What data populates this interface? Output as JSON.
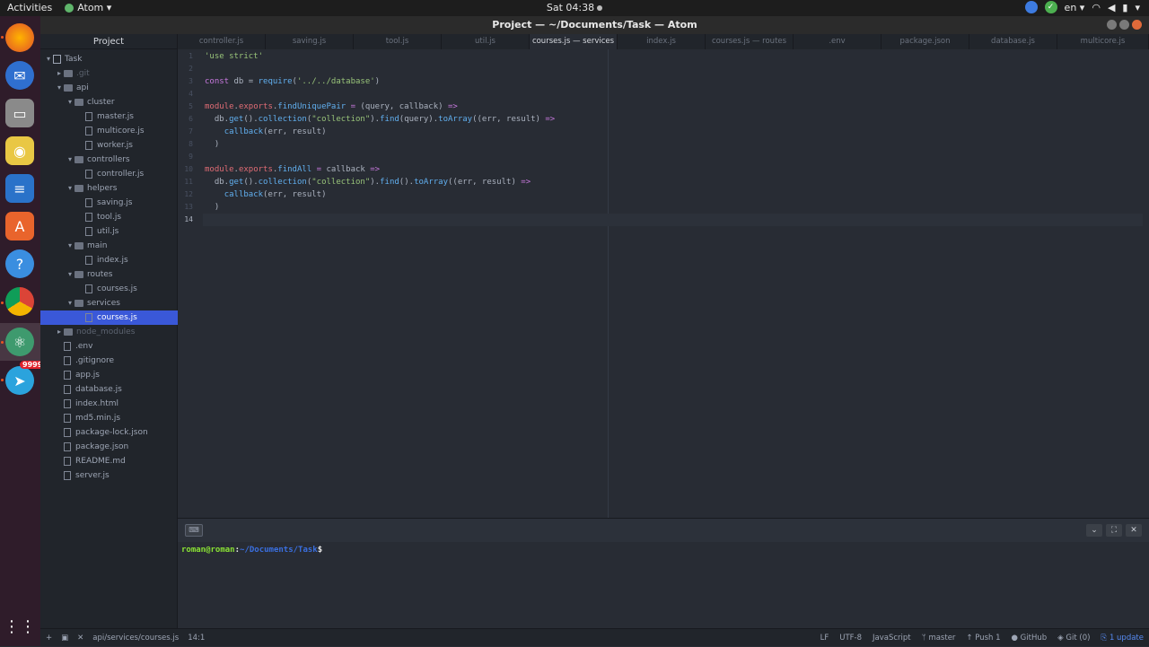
{
  "topbar": {
    "activities": "Activities",
    "app_name": "Atom",
    "clock": "Sat 04:38",
    "lang": "en",
    "tray_icons": [
      "chrome-remote-icon",
      "check-icon",
      "wifi-icon",
      "volume-icon",
      "battery-icon",
      "power-icon"
    ]
  },
  "window": {
    "title": "Project — ~/Documents/Task — Atom"
  },
  "dock": {
    "apps": [
      "firefox",
      "thunderbird",
      "files",
      "rhythmbox",
      "libreoffice-writer",
      "software-center",
      "help",
      "chrome",
      "atom",
      "telegram"
    ],
    "telegram_badge": "9999"
  },
  "tree": {
    "header": "Project",
    "items": [
      {
        "label": "Task",
        "type": "repo",
        "depth": 0,
        "expanded": true
      },
      {
        "label": ".git",
        "type": "folder",
        "depth": 1,
        "expanded": false,
        "dim": true
      },
      {
        "label": "api",
        "type": "folder",
        "depth": 1,
        "expanded": true
      },
      {
        "label": "cluster",
        "type": "folder",
        "depth": 2,
        "expanded": true
      },
      {
        "label": "master.js",
        "type": "file",
        "depth": 3
      },
      {
        "label": "multicore.js",
        "type": "file",
        "depth": 3
      },
      {
        "label": "worker.js",
        "type": "file",
        "depth": 3
      },
      {
        "label": "controllers",
        "type": "folder",
        "depth": 2,
        "expanded": true
      },
      {
        "label": "controller.js",
        "type": "file",
        "depth": 3
      },
      {
        "label": "helpers",
        "type": "folder",
        "depth": 2,
        "expanded": true
      },
      {
        "label": "saving.js",
        "type": "file",
        "depth": 3
      },
      {
        "label": "tool.js",
        "type": "file",
        "depth": 3
      },
      {
        "label": "util.js",
        "type": "file",
        "depth": 3
      },
      {
        "label": "main",
        "type": "folder",
        "depth": 2,
        "expanded": true
      },
      {
        "label": "index.js",
        "type": "file",
        "depth": 3
      },
      {
        "label": "routes",
        "type": "folder",
        "depth": 2,
        "expanded": true
      },
      {
        "label": "courses.js",
        "type": "file",
        "depth": 3
      },
      {
        "label": "services",
        "type": "folder",
        "depth": 2,
        "expanded": true
      },
      {
        "label": "courses.js",
        "type": "file",
        "depth": 3,
        "selected": true
      },
      {
        "label": "node_modules",
        "type": "folder",
        "depth": 1,
        "expanded": false,
        "dim": true
      },
      {
        "label": ".env",
        "type": "file",
        "depth": 1
      },
      {
        "label": ".gitignore",
        "type": "file",
        "depth": 1
      },
      {
        "label": "app.js",
        "type": "file",
        "depth": 1
      },
      {
        "label": "database.js",
        "type": "file",
        "depth": 1
      },
      {
        "label": "index.html",
        "type": "file",
        "depth": 1
      },
      {
        "label": "md5.min.js",
        "type": "file",
        "depth": 1
      },
      {
        "label": "package-lock.json",
        "type": "file",
        "depth": 1
      },
      {
        "label": "package.json",
        "type": "file",
        "depth": 1
      },
      {
        "label": "README.md",
        "type": "file",
        "depth": 1
      },
      {
        "label": "server.js",
        "type": "file",
        "depth": 1
      }
    ]
  },
  "tabs": [
    {
      "label": "controller.js"
    },
    {
      "label": "saving.js"
    },
    {
      "label": "tool.js"
    },
    {
      "label": "util.js"
    },
    {
      "label": "courses.js — services",
      "active": true
    },
    {
      "label": "index.js"
    },
    {
      "label": "courses.js — routes"
    },
    {
      "label": ".env"
    },
    {
      "label": "package.json"
    },
    {
      "label": "database.js"
    },
    {
      "label": "multicore.js"
    }
  ],
  "editor": {
    "cursor_line": 14,
    "lines": [
      [
        [
          "str",
          "'use strict'"
        ]
      ],
      [],
      [
        [
          "kw",
          "const"
        ],
        [
          "pl",
          " db = "
        ],
        [
          "fn",
          "require"
        ],
        [
          "pl",
          "("
        ],
        [
          "str",
          "'../../database'"
        ],
        [
          "pl",
          ")"
        ]
      ],
      [],
      [
        [
          "id",
          "module"
        ],
        [
          "pl",
          "."
        ],
        [
          "id",
          "exports"
        ],
        [
          "pl",
          "."
        ],
        [
          "fn",
          "findUniquePair"
        ],
        [
          "pl",
          " "
        ],
        [
          "op",
          "="
        ],
        [
          "pl",
          " (query, callback) "
        ],
        [
          "op",
          "=>"
        ]
      ],
      [
        [
          "pl",
          "  db."
        ],
        [
          "fn",
          "get"
        ],
        [
          "pl",
          "()."
        ],
        [
          "fn",
          "collection"
        ],
        [
          "pl",
          "("
        ],
        [
          "str",
          "\"collection\""
        ],
        [
          "pl",
          ")."
        ],
        [
          "fn",
          "find"
        ],
        [
          "pl",
          "(query)."
        ],
        [
          "fn",
          "toArray"
        ],
        [
          "pl",
          "((err, result) "
        ],
        [
          "op",
          "=>"
        ]
      ],
      [
        [
          "pl",
          "    "
        ],
        [
          "fn",
          "callback"
        ],
        [
          "pl",
          "(err, result)"
        ]
      ],
      [
        [
          "pl",
          "  )"
        ]
      ],
      [],
      [
        [
          "id",
          "module"
        ],
        [
          "pl",
          "."
        ],
        [
          "id",
          "exports"
        ],
        [
          "pl",
          "."
        ],
        [
          "fn",
          "findAll"
        ],
        [
          "pl",
          " "
        ],
        [
          "op",
          "="
        ],
        [
          "pl",
          " callback "
        ],
        [
          "op",
          "=>"
        ]
      ],
      [
        [
          "pl",
          "  db."
        ],
        [
          "fn",
          "get"
        ],
        [
          "pl",
          "()."
        ],
        [
          "fn",
          "collection"
        ],
        [
          "pl",
          "("
        ],
        [
          "str",
          "\"collection\""
        ],
        [
          "pl",
          ")."
        ],
        [
          "fn",
          "find"
        ],
        [
          "pl",
          "()."
        ],
        [
          "fn",
          "toArray"
        ],
        [
          "pl",
          "((err, result) "
        ],
        [
          "op",
          "=>"
        ]
      ],
      [
        [
          "pl",
          "    "
        ],
        [
          "fn",
          "callback"
        ],
        [
          "pl",
          "(err, result)"
        ]
      ],
      [
        [
          "pl",
          "  )"
        ]
      ],
      []
    ]
  },
  "terminal": {
    "user": "roman@roman",
    "sep": ":",
    "path": "~/Documents/Task",
    "symbol": "$"
  },
  "status": {
    "file_path": "api/services/courses.js",
    "cursor_pos": "14:1",
    "line_ending": "LF",
    "encoding": "UTF-8",
    "grammar": "JavaScript",
    "branch": "master",
    "push": "Push 1",
    "github": "GitHub",
    "git": "Git (0)",
    "update": "1 update"
  }
}
